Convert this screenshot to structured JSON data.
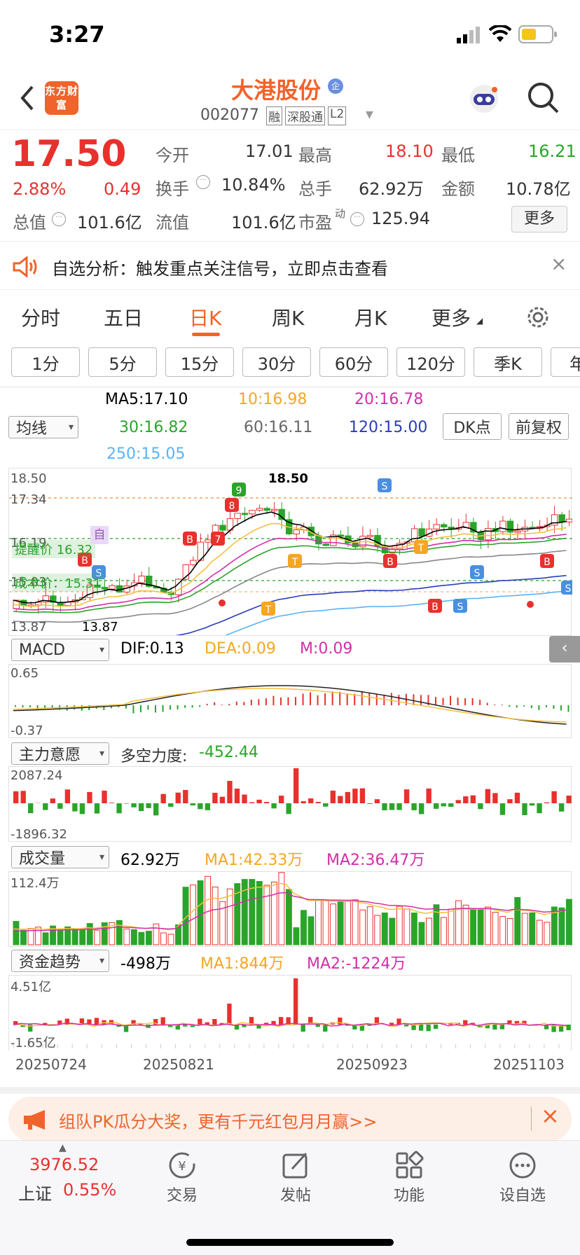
{
  "status": {
    "time": "3:27"
  },
  "header": {
    "logo": "东方财富",
    "stock_name": "大港股份",
    "badge": "企",
    "code": "002077",
    "tags": [
      "融",
      "深股通",
      "L2"
    ]
  },
  "quote": {
    "price": "17.50",
    "pct": "2.88%",
    "chg": "0.49",
    "open_label": "今开",
    "open": "17.01",
    "high_label": "最高",
    "high": "18.10",
    "low_label": "最低",
    "low": "16.21",
    "turn_label": "换手",
    "turn": "10.84%",
    "vol_label": "总手",
    "vol": "62.92万",
    "amt_label": "金额",
    "amt": "10.78亿",
    "mcap_label": "总值",
    "mcap": "101.6亿",
    "fcap_label": "流值",
    "fcap": "101.6亿",
    "pe_label": "市盈",
    "pe_sup": "动",
    "pe": "125.94",
    "more": "更多"
  },
  "notice": {
    "text": "自选分析：触发重点关注信号，立即点击查看"
  },
  "tabs": [
    "分时",
    "五日",
    "日K",
    "周K",
    "月K",
    "更多"
  ],
  "active_tab": "日K",
  "subtabs": [
    "1分",
    "5分",
    "15分",
    "30分",
    "60分",
    "120分",
    "季K",
    "年"
  ],
  "ma": {
    "selector": "均线",
    "ma5": "MA5:17.10",
    "ma10": "10:16.98",
    "ma20": "20:16.78",
    "ma30": "30:16.82",
    "ma60": "60:16.11",
    "ma120": "120:15.00",
    "ma250": "250:15.05",
    "dk": "DK点",
    "fq": "前复权"
  },
  "kline": {
    "top": "18.50",
    "l1": "17.34",
    "l2": "16.19",
    "l3": "15.03",
    "min": "13.87",
    "peak": "18.50",
    "minlabel": "13.87",
    "remind": "提醒价 16.32",
    "cost": "成本价：15.31",
    "self": "自"
  },
  "macd": {
    "selector": "MACD",
    "dif": "DIF:0.13",
    "dea": "DEA:0.09",
    "m": "M:0.09",
    "max": "0.65",
    "min": "-0.37"
  },
  "zl": {
    "selector": "主力意愿",
    "label": "多空力度:",
    "value": "-452.44",
    "max": "2087.24",
    "min": "-1896.32"
  },
  "volume": {
    "selector": "成交量",
    "value": "62.92万",
    "ma1": "MA1:42.33万",
    "ma2": "MA2:36.47万",
    "max": "112.4万"
  },
  "fund": {
    "selector": "资金趋势",
    "value": "-498万",
    "ma1": "MA1:844万",
    "ma2": "MA2:-1224万",
    "max": "4.51亿",
    "min": "-1.65亿"
  },
  "dates": [
    "20250724",
    "20250821",
    "20250923",
    "20251103"
  ],
  "banner": {
    "text": "组队PK瓜分大奖，更有千元红包月月赢>>"
  },
  "bottom": {
    "index_value": "3976.52",
    "index_name": "上证",
    "index_pct": "0.55%",
    "items": [
      "交易",
      "发帖",
      "功能",
      "设自选"
    ]
  },
  "colors": {
    "up": "#e8312d",
    "down": "#2aa52a",
    "accent": "#f0632a"
  }
}
